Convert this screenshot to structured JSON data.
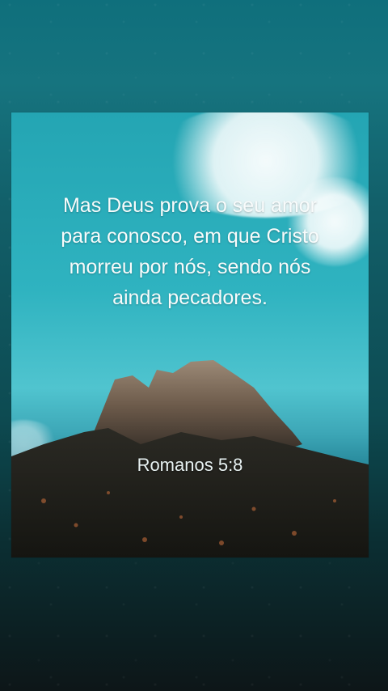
{
  "verse": {
    "text": "Mas Deus prova o seu amor para conosco, em que Cristo morreu por nós, sendo nós ainda pecadores.",
    "reference": "Romanos 5:8"
  },
  "colors": {
    "background_top": "#0f6f7c",
    "background_bottom": "#0d1618",
    "sky": "#2fb3c0",
    "rock": "#5a4a3c",
    "foreground": "#1b1c19"
  }
}
